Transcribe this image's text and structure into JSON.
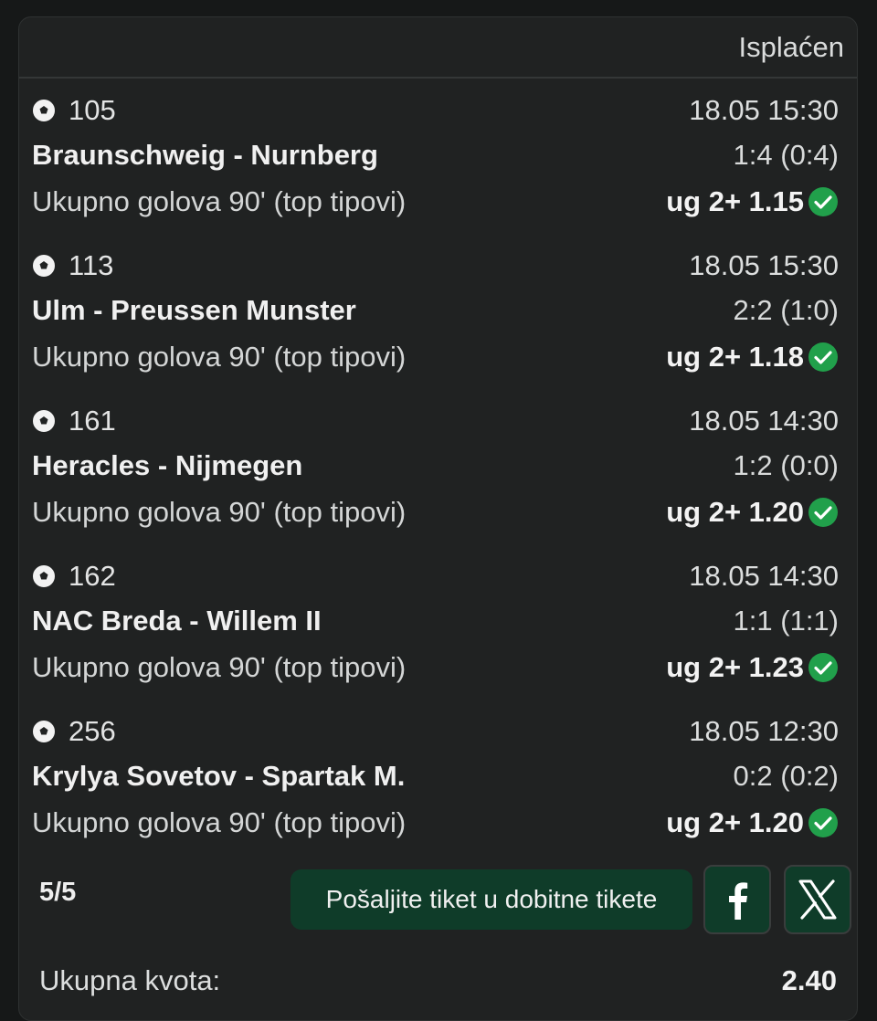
{
  "ticket": {
    "status": "Isplaćen",
    "matches": [
      {
        "number": "105",
        "datetime": "18.05 15:30",
        "teams": "Braunschweig - Nurnberg",
        "score": "1:4 (0:4)",
        "market": "Ukupno golova 90' (top tipovi)",
        "pick": "ug 2+ 1.15",
        "result": "won"
      },
      {
        "number": "113",
        "datetime": "18.05 15:30",
        "teams": "Ulm - Preussen Munster",
        "score": "2:2 (1:0)",
        "market": "Ukupno golova 90' (top tipovi)",
        "pick": "ug 2+ 1.18",
        "result": "won"
      },
      {
        "number": "161",
        "datetime": "18.05 14:30",
        "teams": "Heracles - Nijmegen",
        "score": "1:2 (0:0)",
        "market": "Ukupno golova 90' (top tipovi)",
        "pick": "ug 2+ 1.20",
        "result": "won"
      },
      {
        "number": "162",
        "datetime": "18.05 14:30",
        "teams": "NAC Breda - Willem II",
        "score": "1:1 (1:1)",
        "market": "Ukupno golova 90' (top tipovi)",
        "pick": "ug 2+ 1.23",
        "result": "won"
      },
      {
        "number": "256",
        "datetime": "18.05 12:30",
        "teams": "Krylya Sovetov - Spartak M.",
        "score": "0:2 (0:2)",
        "market": "Ukupno golova 90' (top tipovi)",
        "pick": "ug 2+ 1.20",
        "result": "won"
      }
    ],
    "count": "5/5",
    "send_button": "Pošaljite tiket u dobitne tikete",
    "share_facebook_icon": "facebook-icon",
    "share_x_icon": "x-logo-icon",
    "total_label": "Ukupna kvota:",
    "total_value": "2.40"
  },
  "colors": {
    "background": "#161818",
    "card": "#202222",
    "won_green": "#21a04b",
    "button_green": "#0f3c29"
  }
}
